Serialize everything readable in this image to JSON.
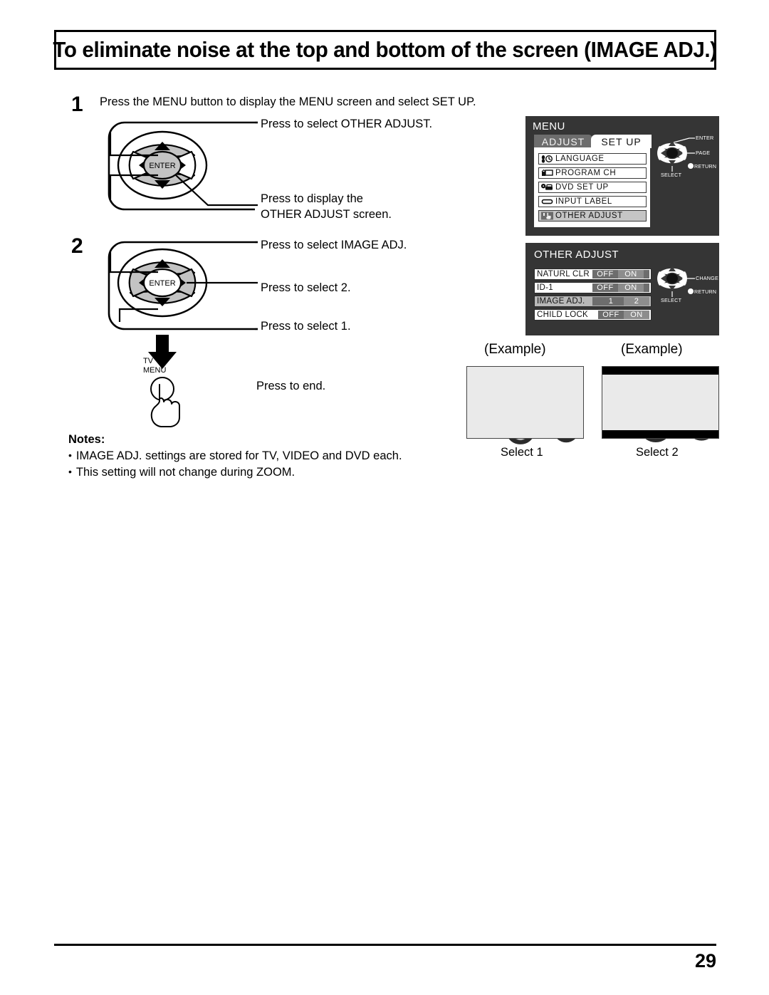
{
  "page": {
    "title": "To eliminate noise at the top and bottom of the screen (IMAGE ADJ.)",
    "number": "29"
  },
  "steps": {
    "one": {
      "number": "1",
      "sentence": "Press the MENU button to display the MENU screen and select SET UP."
    },
    "two": {
      "number": "2"
    }
  },
  "callouts": {
    "select_other_adjust": "Press to select OTHER ADJUST.",
    "display_other_line1": "Press to display the",
    "display_other_line2": "OTHER ADJUST screen.",
    "select_image_adj": "Press to select IMAGE ADJ.",
    "select_2": "Press to select 2.",
    "select_1": "Press to select 1.",
    "press_to_end": "Press to end."
  },
  "remote": {
    "enter_label": "ENTER",
    "tv_menu_line1": "TV",
    "tv_menu_line2": "MENU"
  },
  "notes": {
    "title": "Notes:",
    "bullet": "•",
    "items": [
      "IMAGE ADJ. settings are stored for TV, VIDEO and DVD each.",
      "This setting will not change during ZOOM."
    ]
  },
  "osd_menu": {
    "title": "MENU",
    "tabs": [
      {
        "label": "ADJUST",
        "active": false
      },
      {
        "label": "SET  UP",
        "active": true
      }
    ],
    "items": [
      {
        "label": "LANGUAGE",
        "icon": "language-icon",
        "selected": false
      },
      {
        "label": "PROGRAM  CH",
        "icon": "program-ch-icon",
        "selected": false
      },
      {
        "label": "DVD  SET  UP",
        "icon": "dvd-setup-icon",
        "selected": false
      },
      {
        "label": "INPUT  LABEL",
        "icon": "input-label-icon",
        "selected": false
      },
      {
        "label": "OTHER  ADJUST",
        "icon": "other-adjust-icon",
        "selected": true
      }
    ],
    "nav": {
      "enter": "ENTER",
      "page": "PAGE",
      "return": "RETURN",
      "select": "SELECT"
    }
  },
  "osd_other_adjust": {
    "title": "OTHER ADJUST",
    "rows": [
      {
        "name": "NATURL CLR",
        "selected": false,
        "values": [
          {
            "label": "OFF",
            "active": false
          },
          {
            "label": "ON",
            "active": true
          }
        ]
      },
      {
        "name": "ID-1",
        "selected": false,
        "values": [
          {
            "label": "OFF",
            "active": false
          },
          {
            "label": "ON",
            "active": true
          }
        ]
      },
      {
        "name": "IMAGE ADJ.",
        "selected": true,
        "values": [
          {
            "label": "1",
            "active": false
          },
          {
            "label": "2",
            "active": true
          }
        ]
      },
      {
        "name": "CHILD LOCK",
        "selected": false,
        "values": [
          {
            "label": "OFF",
            "active": false
          },
          {
            "label": "ON",
            "active": true
          }
        ]
      }
    ],
    "nav": {
      "change": "CHANGE",
      "return": "RETURN",
      "select": "SELECT"
    }
  },
  "examples": [
    {
      "caption_top": "(Example)",
      "caption_bottom": "Select 1",
      "letterbox": false
    },
    {
      "caption_top": "(Example)",
      "caption_bottom": "Select 2",
      "letterbox": true
    }
  ],
  "colors": {
    "osd_background": "#353535",
    "osd_selected_row": "#b8b8b8",
    "tab_inactive": "#6d6d6d",
    "tab_active": "#ffffff",
    "value_chip": "#6d6d6d",
    "value_chip_active": "#8d8d8d",
    "remote_arrow_fill": "#c3c3c3"
  }
}
